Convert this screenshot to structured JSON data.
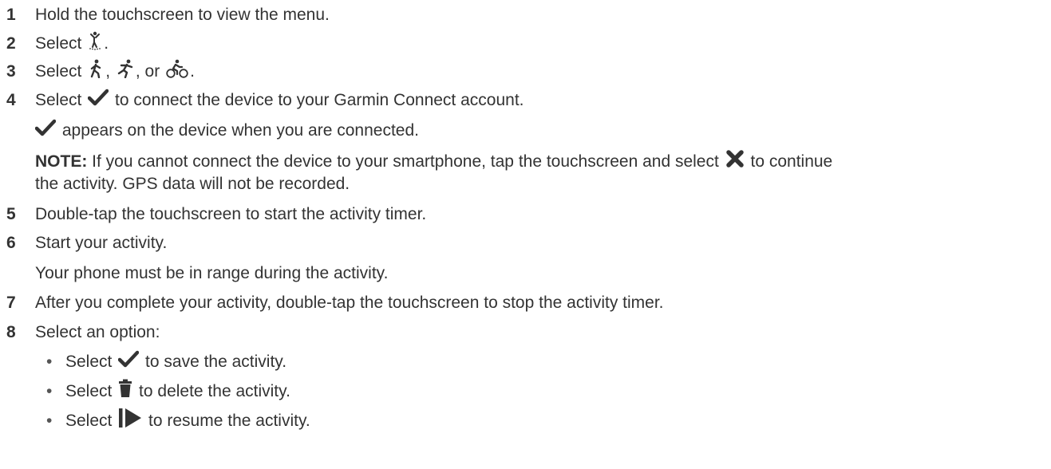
{
  "steps": [
    {
      "num": "1",
      "text": "Hold the touchscreen to view the menu."
    },
    {
      "num": "2",
      "pre": "Select ",
      "post": "."
    },
    {
      "num": "3",
      "pre": "Select ",
      "sep1": ", ",
      "sep2": ", or ",
      "post": "."
    },
    {
      "num": "4",
      "pre": "Select ",
      "post": " to connect the device to your Garmin Connect account.",
      "sub": " appears on the device when you are connected.",
      "note_label": "NOTE:",
      "note_pre": " If you cannot connect the device to your smartphone, tap the touchscreen and select ",
      "note_post": " to continue",
      "note_cont": "the activity. GPS data will not be recorded."
    },
    {
      "num": "5",
      "text": "Double-tap the touchscreen to start the activity timer."
    },
    {
      "num": "6",
      "text": "Start your activity.",
      "sub": "Your phone must be in range during the activity."
    },
    {
      "num": "7",
      "text": "After you complete your activity, double-tap the touchscreen to stop the activity timer."
    },
    {
      "num": "8",
      "text": "Select an option:",
      "options": [
        {
          "pre": "Select ",
          "post": " to save the activity."
        },
        {
          "pre": "Select ",
          "post": " to delete the activity."
        },
        {
          "pre": "Select ",
          "post": " to resume the activity."
        }
      ]
    }
  ],
  "bullet": "•",
  "icons": {
    "activity": "activity-figure-icon",
    "walk": "walk-icon",
    "run": "run-icon",
    "bike": "bike-icon",
    "check": "checkmark-icon",
    "cross": "cross-icon",
    "trash": "trash-icon",
    "resume": "resume-icon"
  }
}
